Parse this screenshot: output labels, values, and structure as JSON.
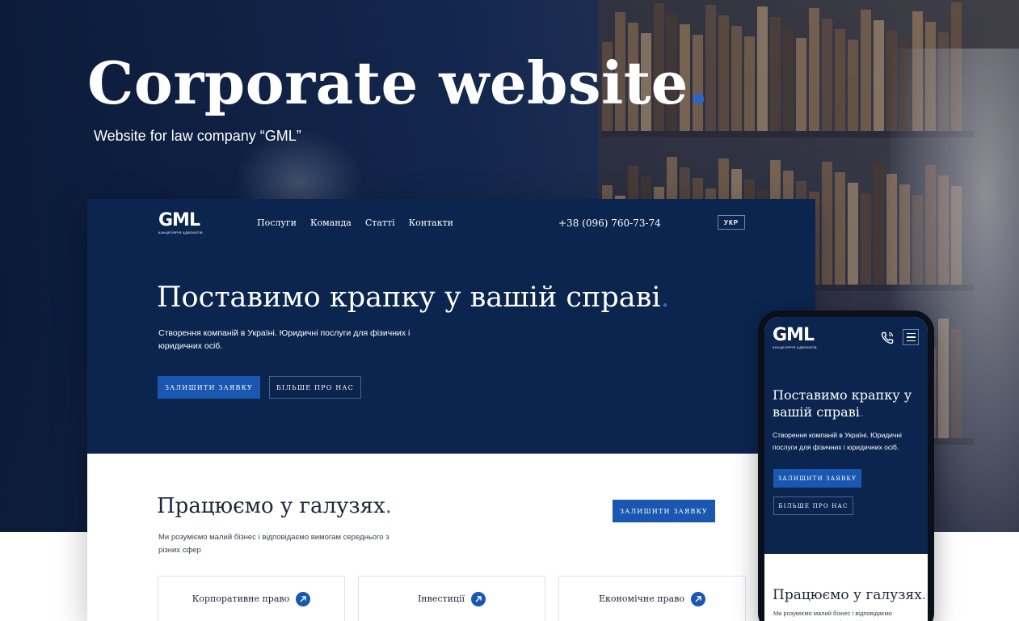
{
  "hero": {
    "title": "Corporate website",
    "title_dot": ".",
    "subtitle": "Website for law company “GML”"
  },
  "desktop": {
    "logo": {
      "mark": "GML",
      "caption": "КАНЦЕЛЯРІЯ АДВОКАТІВ"
    },
    "nav": [
      {
        "label": "Послуги"
      },
      {
        "label": "Команда"
      },
      {
        "label": "Статті"
      },
      {
        "label": "Контакти"
      }
    ],
    "phone": "+38 (096) 760-73-74",
    "lang": "УКР",
    "headline": "Поставимо крапку у вашій справі",
    "headline_dot": ".",
    "description": "Створення компаній в Україні. Юридичні послуги для фізичних і юридичних осіб.",
    "btn_request": "ЗАЛИШИТИ ЗАЯВКУ",
    "btn_more": "БІЛЬШЕ ПРО НАС",
    "industries": {
      "title": "Працюємо у галузях",
      "title_dot": ".",
      "description": "Ми розуміємо малий бізнес і відповідаємо вимогам середнього з різних сфер",
      "btn_request": "ЗАЛИШИТИ ЗАЯВКУ",
      "cards": [
        {
          "label": "Корпоративне право",
          "icon": "arrow-up-right-icon"
        },
        {
          "label": "Інвестиції",
          "icon": "arrow-up-right-icon"
        },
        {
          "label": "Економічне право",
          "icon": "arrow-up-right-icon"
        }
      ]
    }
  },
  "mobile": {
    "logo": {
      "mark": "GML",
      "caption": "КАНЦЕЛЯРІЯ АДВОКАТІВ"
    },
    "headline": "Поставимо крапку у вашій справі",
    "headline_dot": ".",
    "description": "Створення компаній в Україні. Юридичні послуги для фізичних і юридичних осіб.",
    "btn_request": "ЗАЛИШИТИ ЗАЯВКУ",
    "btn_more": "БІЛЬШЕ ПРО НАС",
    "industries_title": "Працюємо у галузях",
    "industries_dot": ".",
    "industries_description": "Ми розуміємо малий бізнес і відповідаємо вимогам середнього з різних сфер"
  },
  "colors": {
    "navy": "#0b254f",
    "accent_blue": "#1a57b0",
    "dot_blue": "#2e63c8"
  }
}
